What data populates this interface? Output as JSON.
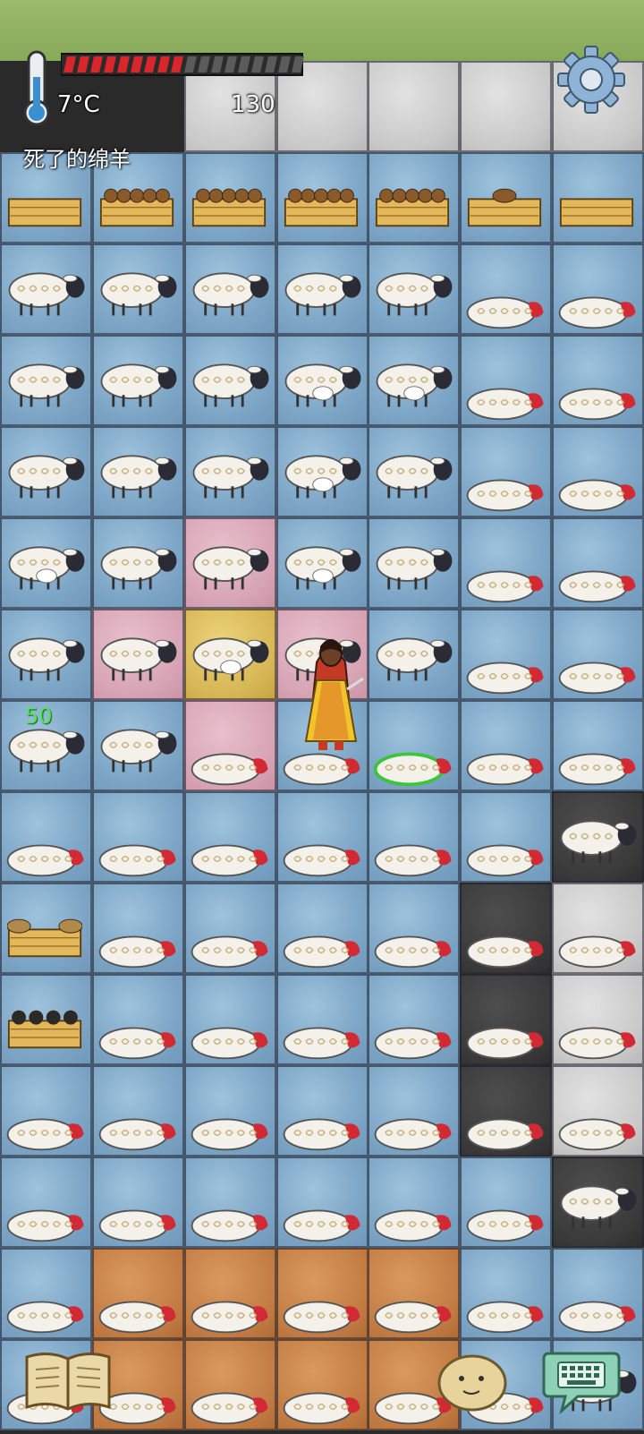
{
  "hud": {
    "temperature": "7°C",
    "food_value": "130",
    "held_object": "死了的绵羊",
    "food_meter": {
      "filled": 9,
      "total": 18
    },
    "floating_number": "50"
  },
  "icons": {
    "thermometer": "thermometer-icon",
    "settings": "gear-icon",
    "book": "open-book-icon",
    "emote": "potato-face-icon",
    "keyboard": "keyboard-chat-icon"
  },
  "colors": {
    "food_bar": "#d9262b",
    "food_bar_empty": "#5b5b5b",
    "floating_number": "#55e35a",
    "floor_blue": "#8fb4d2",
    "floor_pink": "#d6a3b4",
    "floor_yellow": "#d6b654",
    "floor_orange": "#c27b43",
    "floor_dark": "#3a3a3a",
    "floor_grey": "#c9c9c9"
  },
  "grid": {
    "cols": 7,
    "rows": 15,
    "tiles": [
      [
        "grass",
        "grass",
        "grey",
        "grey",
        "grey",
        "grey",
        "grey"
      ],
      [
        "blue",
        "blue",
        "blue",
        "blue",
        "blue",
        "blue",
        "blue"
      ],
      [
        "blue",
        "blue",
        "blue",
        "blue",
        "blue",
        "blue",
        "blue"
      ],
      [
        "blue",
        "blue",
        "blue",
        "blue",
        "blue",
        "blue",
        "blue"
      ],
      [
        "blue",
        "blue",
        "blue",
        "blue",
        "blue",
        "blue",
        "blue"
      ],
      [
        "blue",
        "blue",
        "pink",
        "blue",
        "blue",
        "blue",
        "blue"
      ],
      [
        "blue",
        "pink",
        "yellow",
        "pink",
        "blue",
        "blue",
        "blue"
      ],
      [
        "blue",
        "blue",
        "pink",
        "blue",
        "blue",
        "blue",
        "blue"
      ],
      [
        "blue",
        "blue",
        "blue",
        "blue",
        "blue",
        "blue",
        "dark"
      ],
      [
        "blue",
        "blue",
        "blue",
        "blue",
        "blue",
        "dark",
        "grey"
      ],
      [
        "blue",
        "blue",
        "blue",
        "blue",
        "blue",
        "dark",
        "grey"
      ],
      [
        "blue",
        "blue",
        "blue",
        "blue",
        "blue",
        "dark",
        "grey"
      ],
      [
        "blue",
        "blue",
        "blue",
        "blue",
        "blue",
        "blue",
        "dark"
      ],
      [
        "blue",
        "orange",
        "orange",
        "orange",
        "orange",
        "blue",
        "blue"
      ],
      [
        "blue",
        "orange",
        "orange",
        "orange",
        "orange",
        "blue",
        "blue"
      ]
    ],
    "objects": [
      [
        "none",
        "none",
        "none",
        "none",
        "none",
        "none",
        "none"
      ],
      [
        "box",
        "box-bread",
        "box-bread",
        "box-bread",
        "box-bread",
        "box-bread-single",
        "box"
      ],
      [
        "sheep",
        "sheep",
        "sheep",
        "sheep",
        "sheep",
        "dead",
        "dead"
      ],
      [
        "sheep",
        "sheep",
        "sheep",
        "sheep-lamb",
        "sheep-lamb",
        "dead",
        "dead"
      ],
      [
        "sheep",
        "sheep",
        "sheep",
        "sheep-lamb",
        "sheep",
        "dead",
        "dead"
      ],
      [
        "sheep-lamb",
        "sheep",
        "sheep",
        "sheep-lamb",
        "sheep",
        "dead",
        "dead"
      ],
      [
        "sheep",
        "sheep",
        "sheep-lamb",
        "sheep",
        "sheep",
        "dead",
        "dead"
      ],
      [
        "sheep",
        "sheep",
        "dead",
        "dead",
        "dead-sick",
        "dead",
        "dead"
      ],
      [
        "dead",
        "dead",
        "dead",
        "dead",
        "dead",
        "dead",
        "sheep"
      ],
      [
        "box-wool",
        "dead",
        "dead",
        "dead",
        "dead",
        "dead",
        "dead"
      ],
      [
        "box-charcoal",
        "dead",
        "dead",
        "dead",
        "dead",
        "dead",
        "dead"
      ],
      [
        "dead",
        "dead",
        "dead",
        "dead",
        "dead",
        "dead",
        "dead"
      ],
      [
        "dead",
        "dead",
        "dead",
        "dead",
        "dead",
        "dead",
        "sheep"
      ],
      [
        "dead",
        "dead",
        "dead",
        "dead",
        "dead",
        "dead",
        "dead"
      ],
      [
        "dead",
        "dead",
        "dead",
        "dead",
        "dead",
        "dead",
        "sheep"
      ]
    ]
  }
}
